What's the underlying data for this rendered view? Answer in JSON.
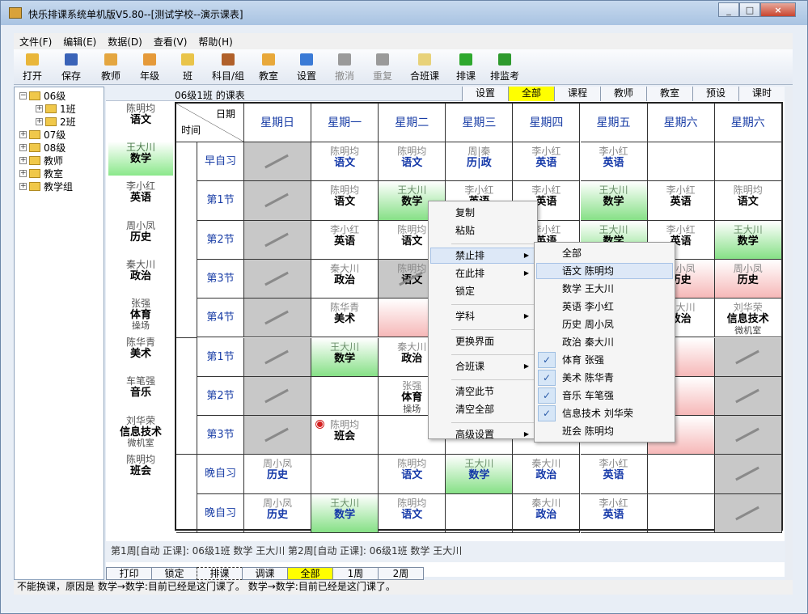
{
  "window": {
    "title": "快乐排课系统单机版V5.80--[测试学校--演示课表]"
  },
  "menu": [
    "文件(F)",
    "编辑(E)",
    "数据(D)",
    "查看(V)",
    "帮助(H)"
  ],
  "toolbar": [
    {
      "label": "打开",
      "icon": "folder-open-icon",
      "color": "#e9b63a",
      "enabled": true
    },
    {
      "label": "保存",
      "icon": "save-disk-icon",
      "color": "#3a63b8",
      "enabled": true
    },
    {
      "label": "教师",
      "icon": "teacher-icon",
      "color": "#e4a640",
      "enabled": true
    },
    {
      "label": "年级",
      "icon": "grade-icon",
      "color": "#e59a3a",
      "enabled": true
    },
    {
      "label": "班",
      "icon": "class-icon",
      "color": "#e9c44a",
      "enabled": true
    },
    {
      "label": "科目/组",
      "icon": "subject-group-icon",
      "color": "#b0602a",
      "enabled": true
    },
    {
      "label": "教室",
      "icon": "classroom-icon",
      "color": "#e8a83a",
      "enabled": true
    },
    {
      "label": "设置",
      "icon": "settings-icon",
      "color": "#3a7ad6",
      "enabled": true
    },
    {
      "label": "撤消",
      "icon": "undo-icon",
      "color": "#9a9a9a",
      "enabled": false
    },
    {
      "label": "重复",
      "icon": "redo-icon",
      "color": "#9a9a9a",
      "enabled": false
    },
    {
      "label": "合班课",
      "icon": "merge-class-icon",
      "color": "#e8d27a",
      "enabled": true
    },
    {
      "label": "排课",
      "icon": "schedule-run-icon",
      "color": "#2ea82e",
      "enabled": true
    },
    {
      "label": "排监考",
      "icon": "exam-schedule-icon",
      "color": "#2e9a2e",
      "enabled": true
    }
  ],
  "tree": [
    {
      "label": "06级",
      "pm": "−",
      "level": 0
    },
    {
      "label": "1班",
      "pm": "+",
      "level": 1
    },
    {
      "label": "2班",
      "pm": "+",
      "level": 1
    },
    {
      "label": "07级",
      "pm": "+",
      "level": 0
    },
    {
      "label": "08级",
      "pm": "+",
      "level": 0
    },
    {
      "label": "教师",
      "pm": "+",
      "level": 0
    },
    {
      "label": "教室",
      "pm": "+",
      "level": 0
    },
    {
      "label": "教学组",
      "pm": "+",
      "level": 0
    }
  ],
  "classbar": {
    "label": "06级1班 的课表",
    "tabs": [
      "设置",
      "全部",
      "课程",
      "教师",
      "教室",
      "预设",
      "课时"
    ],
    "active": "全部"
  },
  "subjects": [
    {
      "t": "陈明均",
      "n": "语文",
      "x": ""
    },
    {
      "t": "王大川",
      "n": "数学",
      "x": "",
      "sel": true
    },
    {
      "t": "李小红",
      "n": "英语",
      "x": ""
    },
    {
      "t": "周小凤",
      "n": "历史",
      "x": ""
    },
    {
      "t": "秦大川",
      "n": "政治",
      "x": ""
    },
    {
      "t": "张强",
      "n": "体育",
      "x": "操场"
    },
    {
      "t": "陈华青",
      "n": "美术",
      "x": ""
    },
    {
      "t": "车笔强",
      "n": "音乐",
      "x": ""
    },
    {
      "t": "刘华荣",
      "n": "信息技术",
      "x": "微机室"
    },
    {
      "t": "陈明均",
      "n": "班会",
      "x": ""
    }
  ],
  "grid": {
    "corner_top": "日期",
    "corner_bottom": "时间",
    "days": [
      "星期日",
      "星期一",
      "星期二",
      "星期三",
      "星期四",
      "星期五",
      "星期六",
      "星期六"
    ],
    "periods": [
      "早自习",
      "第1节",
      "第2节",
      "第3节",
      "第4节",
      "第1节",
      "第2节",
      "第3节",
      "晚自习",
      "晚自习"
    ],
    "rows": [
      [
        {
          "s": "gray"
        },
        {
          "t": "陈明均",
          "n": "语文",
          "b": true
        },
        {
          "t": "陈明均",
          "n": "语文",
          "b": true
        },
        {
          "t": "周|秦",
          "n": "历|政",
          "b": true
        },
        {
          "t": "李小红",
          "n": "英语",
          "b": true
        },
        {
          "t": "李小红",
          "n": "英语",
          "b": true
        },
        {},
        {}
      ],
      [
        {
          "s": "gray"
        },
        {
          "t": "陈明均",
          "n": "语文"
        },
        {
          "t": "王大川",
          "n": "数学",
          "s": "green"
        },
        {
          "t": "李小红",
          "n": "英语"
        },
        {
          "t": "李小红",
          "n": "英语"
        },
        {
          "t": "王大川",
          "n": "数学",
          "s": "green"
        },
        {
          "t": "李小红",
          "n": "英语"
        },
        {
          "t": "陈明均",
          "n": "语文"
        }
      ],
      [
        {
          "s": "gray"
        },
        {
          "t": "李小红",
          "n": "英语"
        },
        {
          "t": "陈明均",
          "n": "语文"
        },
        {},
        {
          "t": "李小红",
          "n": "英语"
        },
        {
          "t": "王大川",
          "n": "数学",
          "s": "green"
        },
        {
          "t": "李小红",
          "n": "英语"
        },
        {
          "t": "王大川",
          "n": "数学",
          "s": "green"
        }
      ],
      [
        {
          "s": "gray"
        },
        {
          "t": "秦大川",
          "n": "政治"
        },
        {
          "t": "陈明均",
          "n": "语文",
          "s": "gray"
        },
        {},
        {},
        {},
        {
          "t": "周小凤",
          "n": "历史",
          "s": "pink"
        },
        {
          "t": "周小凤",
          "n": "历史",
          "s": "pink"
        }
      ],
      [
        {
          "s": "gray"
        },
        {
          "t": "陈华青",
          "n": "美术"
        },
        {
          "s": "pink"
        },
        {},
        {},
        {},
        {
          "t": "秦大川",
          "n": "政治"
        },
        {
          "t": "刘华荣",
          "n": "信息技术",
          "x": "微机室"
        }
      ],
      [
        {
          "s": "gray"
        },
        {
          "t": "王大川",
          "n": "数学",
          "s": "green"
        },
        {
          "t": "秦大川",
          "n": "政治"
        },
        {},
        {},
        {},
        {
          "s": "pink"
        },
        {
          "s": "gray"
        }
      ],
      [
        {
          "s": "gray"
        },
        {},
        {
          "t": "张强",
          "n": "体育",
          "x": "操场"
        },
        {},
        {},
        {},
        {
          "s": "pink"
        },
        {
          "s": "gray"
        }
      ],
      [
        {
          "s": "gray"
        },
        {
          "t": "陈明均",
          "n": "班会",
          "dot": true
        },
        {},
        {},
        {},
        {},
        {
          "s": "pink"
        },
        {
          "s": "gray"
        }
      ],
      [
        {
          "t": "周小凤",
          "n": "历史",
          "b": true
        },
        {},
        {
          "t": "陈明均",
          "n": "语文",
          "b": true
        },
        {
          "t": "王大川",
          "n": "数学",
          "b": true,
          "s": "green"
        },
        {
          "t": "秦大川",
          "n": "政治",
          "b": true
        },
        {
          "t": "李小红",
          "n": "英语",
          "b": true
        },
        {},
        {
          "s": "gray"
        }
      ],
      [
        {
          "t": "周小凤",
          "n": "历史",
          "b": true
        },
        {
          "t": "王大川",
          "n": "数学",
          "b": true,
          "s": "green"
        },
        {
          "t": "陈明均",
          "n": "语文",
          "b": true
        },
        {},
        {
          "t": "秦大川",
          "n": "政治",
          "b": true
        },
        {
          "t": "李小红",
          "n": "英语",
          "b": true
        },
        {},
        {
          "s": "gray"
        }
      ]
    ]
  },
  "context_menu": {
    "items": [
      {
        "label": "复制"
      },
      {
        "label": "粘贴"
      },
      {
        "sep": true
      },
      {
        "label": "禁止排",
        "sub": true,
        "hl": true
      },
      {
        "label": "在此排",
        "sub": true
      },
      {
        "label": "锁定"
      },
      {
        "sep": true
      },
      {
        "label": "学科",
        "sub": true
      },
      {
        "sep": true
      },
      {
        "label": "更换界面"
      },
      {
        "sep": true
      },
      {
        "label": "合班课",
        "sub": true
      },
      {
        "sep": true
      },
      {
        "label": "清空此节"
      },
      {
        "label": "清空全部"
      },
      {
        "sep": true
      },
      {
        "label": "高级设置",
        "sub": true
      }
    ]
  },
  "submenu": {
    "items": [
      {
        "label": "全部"
      },
      {
        "label": "语文 陈明均",
        "hl": true
      },
      {
        "label": "数学 王大川"
      },
      {
        "label": "英语 李小红"
      },
      {
        "label": "历史 周小凤"
      },
      {
        "label": "政治 秦大川"
      },
      {
        "label": "体育 张强",
        "checked": true
      },
      {
        "label": "美术 陈华青",
        "checked": true
      },
      {
        "label": "音乐 车笔强",
        "checked": true
      },
      {
        "label": "信息技术 刘华荣",
        "checked": true
      },
      {
        "label": "班会 陈明均"
      }
    ],
    "check_glyph": "✓"
  },
  "log": {
    "text": "第1周[自动 正课]: 06级1班 数学 王大川    第2周[自动 正课]: 06级1班 数学 王大川"
  },
  "bottom_tabs": {
    "items": [
      "打印",
      "锁定",
      "排课",
      "调课",
      "全部",
      "1周",
      "2周"
    ],
    "active": "全部",
    "focused": "排课"
  },
  "status": {
    "text": "不能换课，原因是 数学→数学:目前已经是这门课了。   数学→数学:目前已经是这门课了。"
  },
  "window_buttons": [
    "_",
    "□",
    "×"
  ]
}
